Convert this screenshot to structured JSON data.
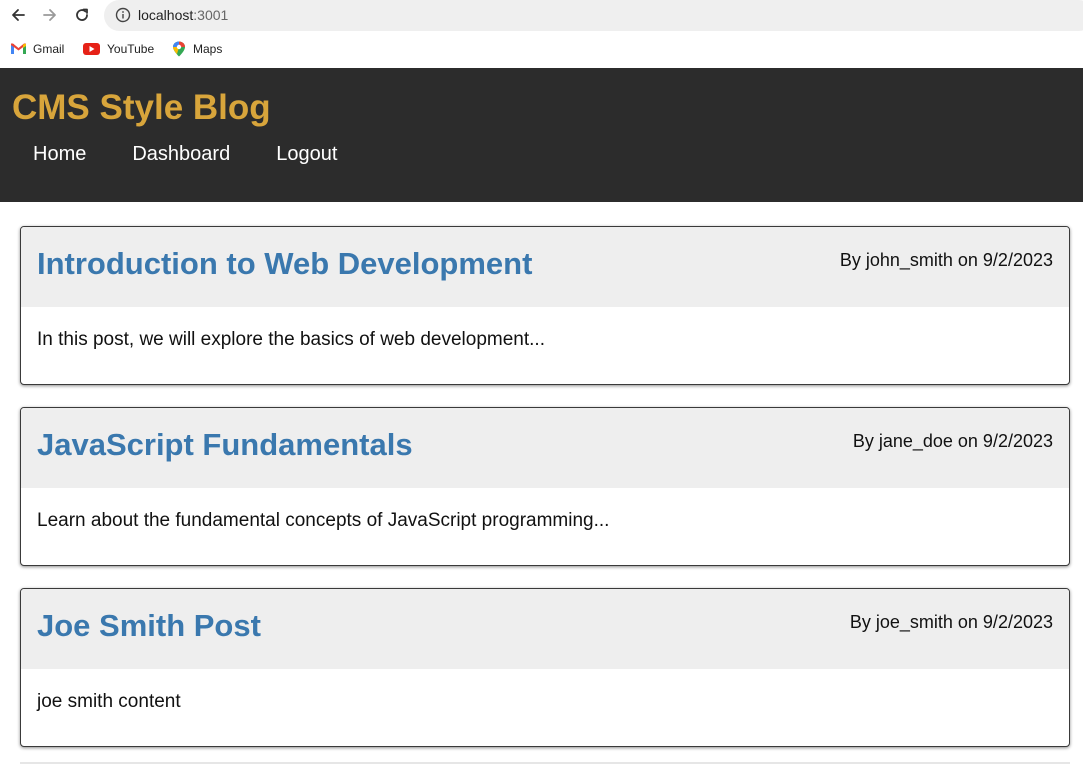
{
  "browser": {
    "url_host": "localhost",
    "url_port": ":3001",
    "bookmarks": [
      {
        "label": "Gmail",
        "icon": "gmail-icon"
      },
      {
        "label": "YouTube",
        "icon": "youtube-icon"
      },
      {
        "label": "Maps",
        "icon": "maps-icon"
      }
    ]
  },
  "header": {
    "title": "CMS Style Blog",
    "nav": [
      "Home",
      "Dashboard",
      "Logout"
    ],
    "title_color": "#d8a53b",
    "background": "#2c2c2c"
  },
  "posts": [
    {
      "title": "Introduction to Web Development",
      "meta": "By john_smith on 9/2/2023",
      "body": "In this post, we will explore the basics of web development..."
    },
    {
      "title": "JavaScript Fundamentals",
      "meta": "By jane_doe on 9/2/2023",
      "body": "Learn about the fundamental concepts of JavaScript programming..."
    },
    {
      "title": "Joe Smith Post",
      "meta": "By joe_smith on 9/2/2023",
      "body": "joe smith content"
    }
  ],
  "colors": {
    "post_title": "#3a78ae",
    "post_header_bg": "#eeeeee"
  }
}
